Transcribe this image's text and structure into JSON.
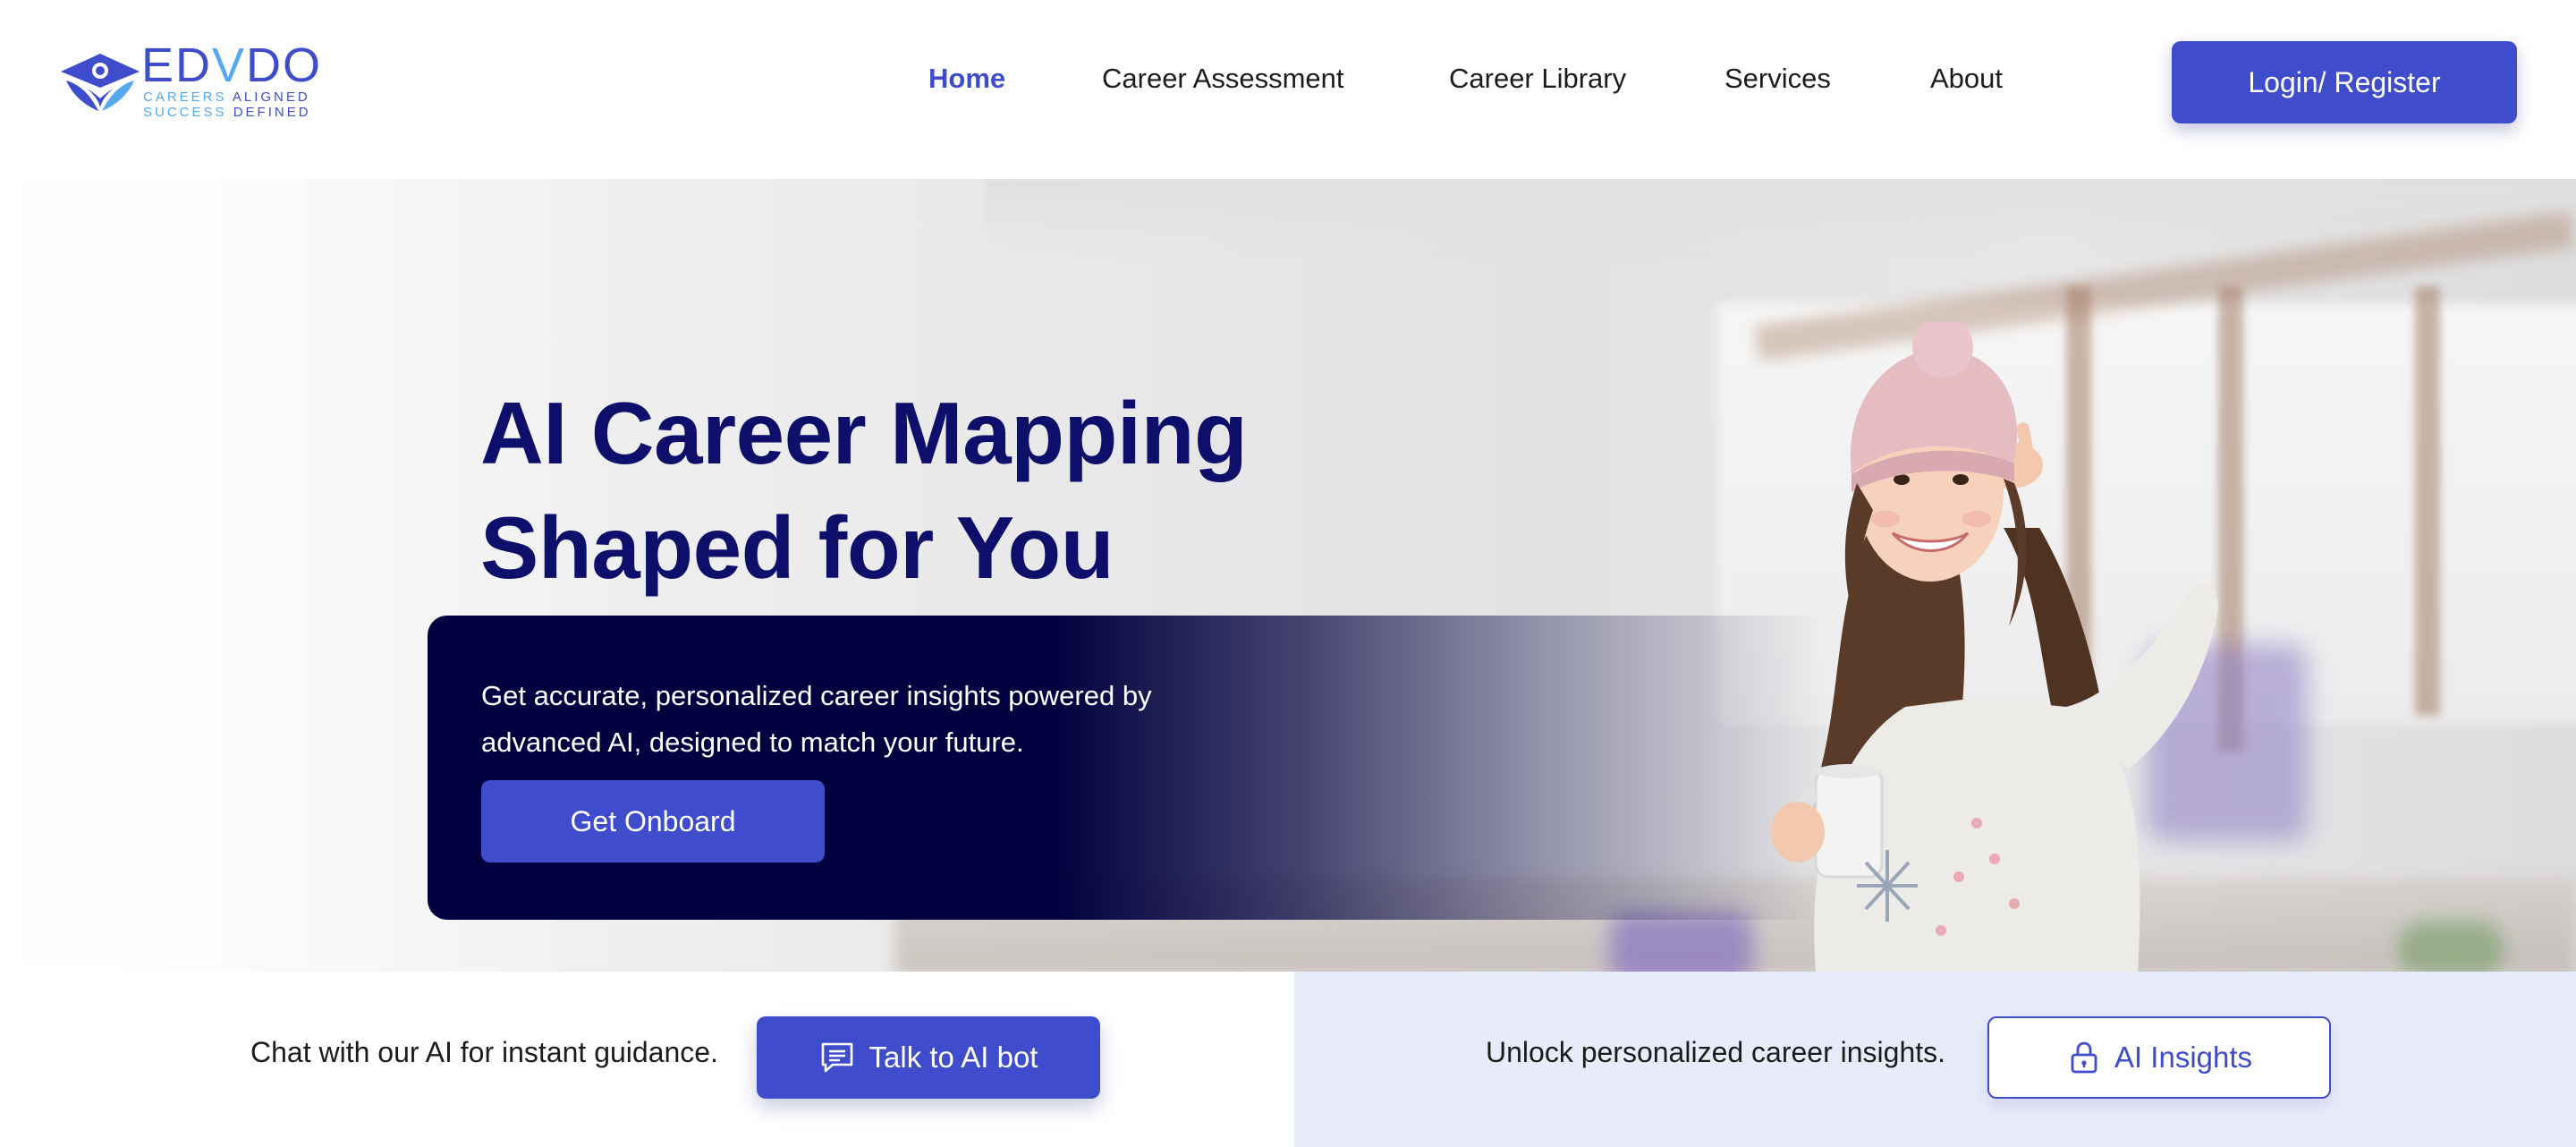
{
  "brand": {
    "name_part1": "ED",
    "name_part2": "V",
    "name_part3": "DO",
    "tagline_left_1": "CAREERS",
    "tagline_right_1": "ALIGNED",
    "tagline_left_2": "SUCCESS",
    "tagline_right_2": "DEFINED",
    "logo_icon": "graduation-person-icon"
  },
  "nav": {
    "items": [
      {
        "label": "Home",
        "active": true
      },
      {
        "label": "Career Assessment",
        "active": false
      },
      {
        "label": "Career Library",
        "active": false
      },
      {
        "label": "Services",
        "active": false
      },
      {
        "label": "About",
        "active": false
      }
    ],
    "login_label": "Login/ Register"
  },
  "hero": {
    "title_line1": "AI Career Mapping",
    "title_line2": "Shaped for You",
    "description": "Get accurate, personalized career insights powered by advanced AI, designed to match your future.",
    "cta_label": "Get Onboard",
    "image_subject": "smiling girl in pink knit hat holding a white mug"
  },
  "bottom": {
    "chat_text": "Chat with our AI for instant guidance.",
    "chat_button_label": "Talk to AI bot",
    "chat_button_icon": "chat-message-icon",
    "insights_text": "Unlock personalized career insights.",
    "insights_button_label": "AI Insights",
    "insights_button_icon": "lock-icon"
  },
  "colors": {
    "primary": "#3f4ccc",
    "navy": "#0d0f6b",
    "panel": "#02013f",
    "accent_light": "#56a8f0",
    "insights_bg": "#e8ecfa"
  }
}
